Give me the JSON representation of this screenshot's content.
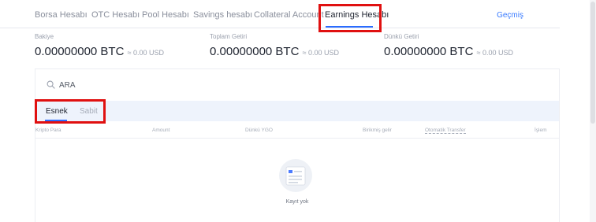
{
  "tabs": [
    {
      "label": "Borsa Hesabı"
    },
    {
      "label": "OTC Hesabı"
    },
    {
      "label": "Pool Hesabı"
    },
    {
      "label": "Savings hesabı"
    },
    {
      "label": "Collateral Account"
    },
    {
      "label": "Earnings Hesabı",
      "active": true
    }
  ],
  "history_link": "Geçmiş",
  "stats": {
    "balance": {
      "label": "Bakiye",
      "value": "0.00000000 BTC",
      "usd": "≈ 0.00 USD"
    },
    "total_earnings": {
      "label": "Toplam Getiri",
      "value": "0.00000000 BTC",
      "usd": "≈ 0.00 USD"
    },
    "yesterday": {
      "label": "Dünkü Getiri",
      "value": "0.00000000 BTC",
      "usd": "≈ 0.00 USD"
    }
  },
  "search": {
    "placeholder": "ARA"
  },
  "subtabs": [
    {
      "label": "Esnek",
      "active": true
    },
    {
      "label": "Sabit",
      "active": false
    }
  ],
  "table": {
    "columns": [
      "Kripto Para",
      "Amount",
      "Dünkü YGO",
      "Birikmiş gelir",
      "Otomatik Transfer",
      "İşlem"
    ]
  },
  "empty_state": {
    "text": "Kayıt yok"
  },
  "colors": {
    "accent": "#2a6cff",
    "highlight": "#e01010",
    "link": "#3a7bff"
  }
}
